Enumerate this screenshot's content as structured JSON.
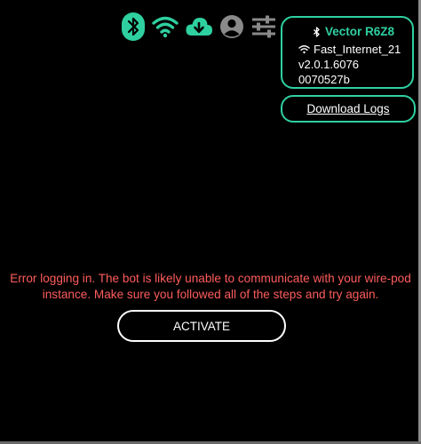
{
  "colors": {
    "accent": "#2fd0a0",
    "error": "#ff5c5c",
    "background": "#000000",
    "text": "#ffffff",
    "muted_icon": "#8a8a8a"
  },
  "status_icons": [
    "bluetooth-icon",
    "wifi-icon",
    "cloud-download-icon",
    "account-icon",
    "settings-sliders-icon"
  ],
  "device": {
    "name": "Vector R6Z8",
    "wifi": "Fast_Internet_21",
    "version": "v2.0.1.6076",
    "serial": "0070527b"
  },
  "download_logs_label": "Download Logs",
  "error_message": "Error logging in. The bot is likely unable to communicate with your wire-pod instance. Make sure you followed all of the steps and try again.",
  "activate_label": "ACTIVATE"
}
